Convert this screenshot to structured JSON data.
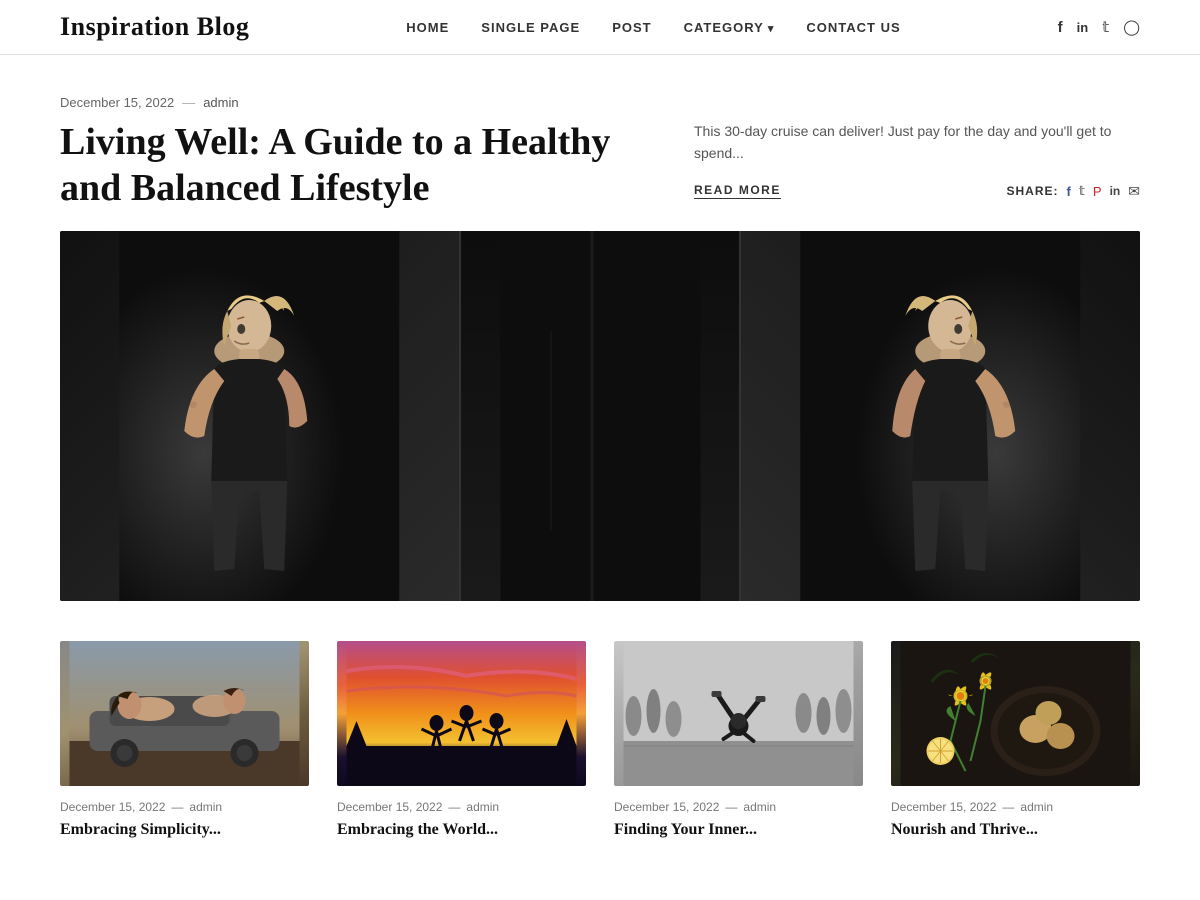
{
  "site": {
    "title": "Inspiration Blog"
  },
  "nav": {
    "items": [
      {
        "label": "HOME",
        "id": "home",
        "dropdown": false
      },
      {
        "label": "SINGLE PAGE",
        "id": "single-page",
        "dropdown": false
      },
      {
        "label": "POST",
        "id": "post",
        "dropdown": false
      },
      {
        "label": "CATEGORY",
        "id": "category",
        "dropdown": true
      },
      {
        "label": "CONTACT US",
        "id": "contact",
        "dropdown": false
      }
    ],
    "social": [
      {
        "icon": "f",
        "name": "facebook",
        "symbol": "𝐟"
      },
      {
        "icon": "in",
        "name": "linkedin",
        "symbol": "in"
      },
      {
        "icon": "t",
        "name": "twitter",
        "symbol": "𝕥"
      },
      {
        "icon": "ig",
        "name": "instagram",
        "symbol": "⬛"
      }
    ]
  },
  "featured": {
    "date": "December 15, 2022",
    "dash": "—",
    "author": "admin",
    "title": "Living Well: A Guide to a Healthy and Balanced Lifestyle",
    "excerpt": "This 30-day cruise can deliver! Just pay for the day and you'll get to spend...",
    "read_more": "READ MORE",
    "share_label": "SHARE:"
  },
  "grid_posts": [
    {
      "date": "December 15, 2022",
      "dash": "—",
      "author": "admin",
      "title": "Embracing Simplicity...",
      "image_type": "girls-car"
    },
    {
      "date": "December 15, 2022",
      "dash": "—",
      "author": "admin",
      "title": "Embracing the World...",
      "image_type": "sunset-jump"
    },
    {
      "date": "December 15, 2022",
      "dash": "—",
      "author": "admin",
      "title": "Finding Your Inner...",
      "image_type": "street-dance"
    },
    {
      "date": "December 15, 2022",
      "dash": "—",
      "author": "admin",
      "title": "Nourish and Thrive...",
      "image_type": "food"
    }
  ]
}
